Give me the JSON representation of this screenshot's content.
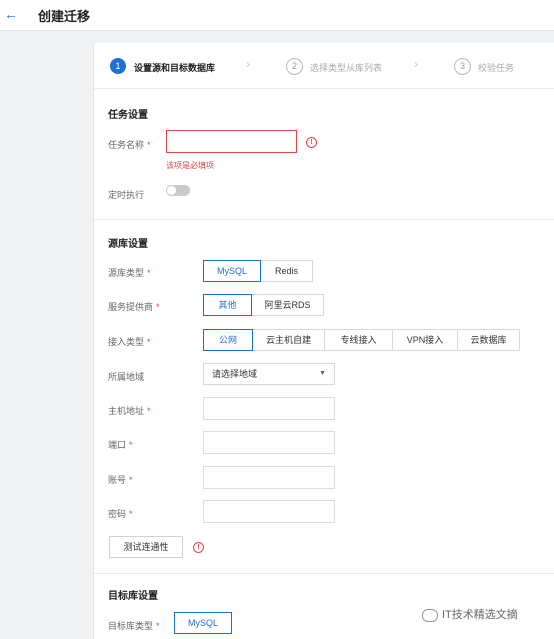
{
  "header": {
    "title": "创建迁移"
  },
  "steps": [
    {
      "num": "1",
      "label": "设置源和目标数据库"
    },
    {
      "num": "2",
      "label": "选择类型从库列表"
    },
    {
      "num": "3",
      "label": "校验任务"
    }
  ],
  "task_settings": {
    "title": "任务设置",
    "name_label": "任务名称",
    "name_value": "",
    "name_error": "该项是必填项",
    "schedule_label": "定时执行"
  },
  "source_settings": {
    "title": "源库设置",
    "type_label": "源库类型",
    "type_options": [
      "MySQL",
      "Redis"
    ],
    "provider_label": "服务提供商",
    "provider_options": [
      "其他",
      "阿里云RDS"
    ],
    "access_label": "接入类型",
    "access_options": [
      "公网",
      "云主机自建",
      "专线接入",
      "VPN接入",
      "云数据库"
    ],
    "region_label": "所属地域",
    "region_value": "请选择地域",
    "host_label": "主机地址",
    "port_label": "端口",
    "account_label": "账号",
    "password_label": "密码",
    "test_button": "测试连通性"
  },
  "target_settings": {
    "title": "目标库设置",
    "type_label": "目标库类型",
    "type_value": "MySQL"
  },
  "watermark": "IT技术精选文摘",
  "required_mark": "*",
  "colors": {
    "accent": "#1e6fd9",
    "error": "#e54545"
  }
}
